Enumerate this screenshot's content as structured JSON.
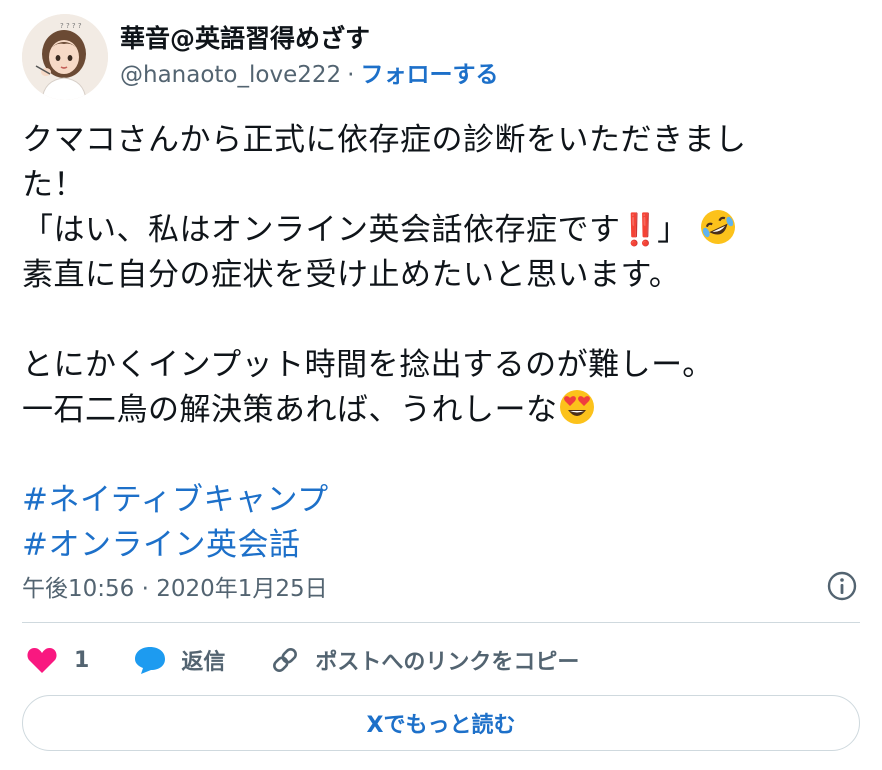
{
  "author": {
    "display_name": "華音@英語習得めざす",
    "handle": "@hanaoto_love222",
    "separator": "·",
    "follow_label": "フォローする"
  },
  "tweet": {
    "lines": [
      "クマコさんから正式に依存症の診断をいただきまし",
      "た！",
      "「はい、私はオンライン英会話依存症です",
      "‼️",
      "」",
      "素直に自分の症状を受け止めたいと思います。",
      "とにかくインプット時間を捻出するのが難しー。",
      "一石二鳥の解決策あれば、うれしーな"
    ],
    "hashtags": [
      "#ネイティブキャンプ",
      "#オンライン英会話"
    ]
  },
  "timestamp": "午後10:56 · 2020年1月25日",
  "actions": {
    "like_count": "1",
    "reply_label": "返信",
    "copy_link_label": "ポストへのリンクをコピー"
  },
  "read_more_label": "Xでもっと読む",
  "colors": {
    "link": "#1d70c9",
    "heart": "#f91880",
    "reply_bubble": "#1d9bf0",
    "muted": "#536471"
  },
  "icons": {
    "avatar": "avatar-illustration",
    "info": "info-icon",
    "like": "heart-icon",
    "reply": "speech-bubble-icon",
    "copy": "link-icon",
    "emoji1": "rolling-laughing-emoji",
    "emoji2": "heart-eyes-emoji"
  }
}
